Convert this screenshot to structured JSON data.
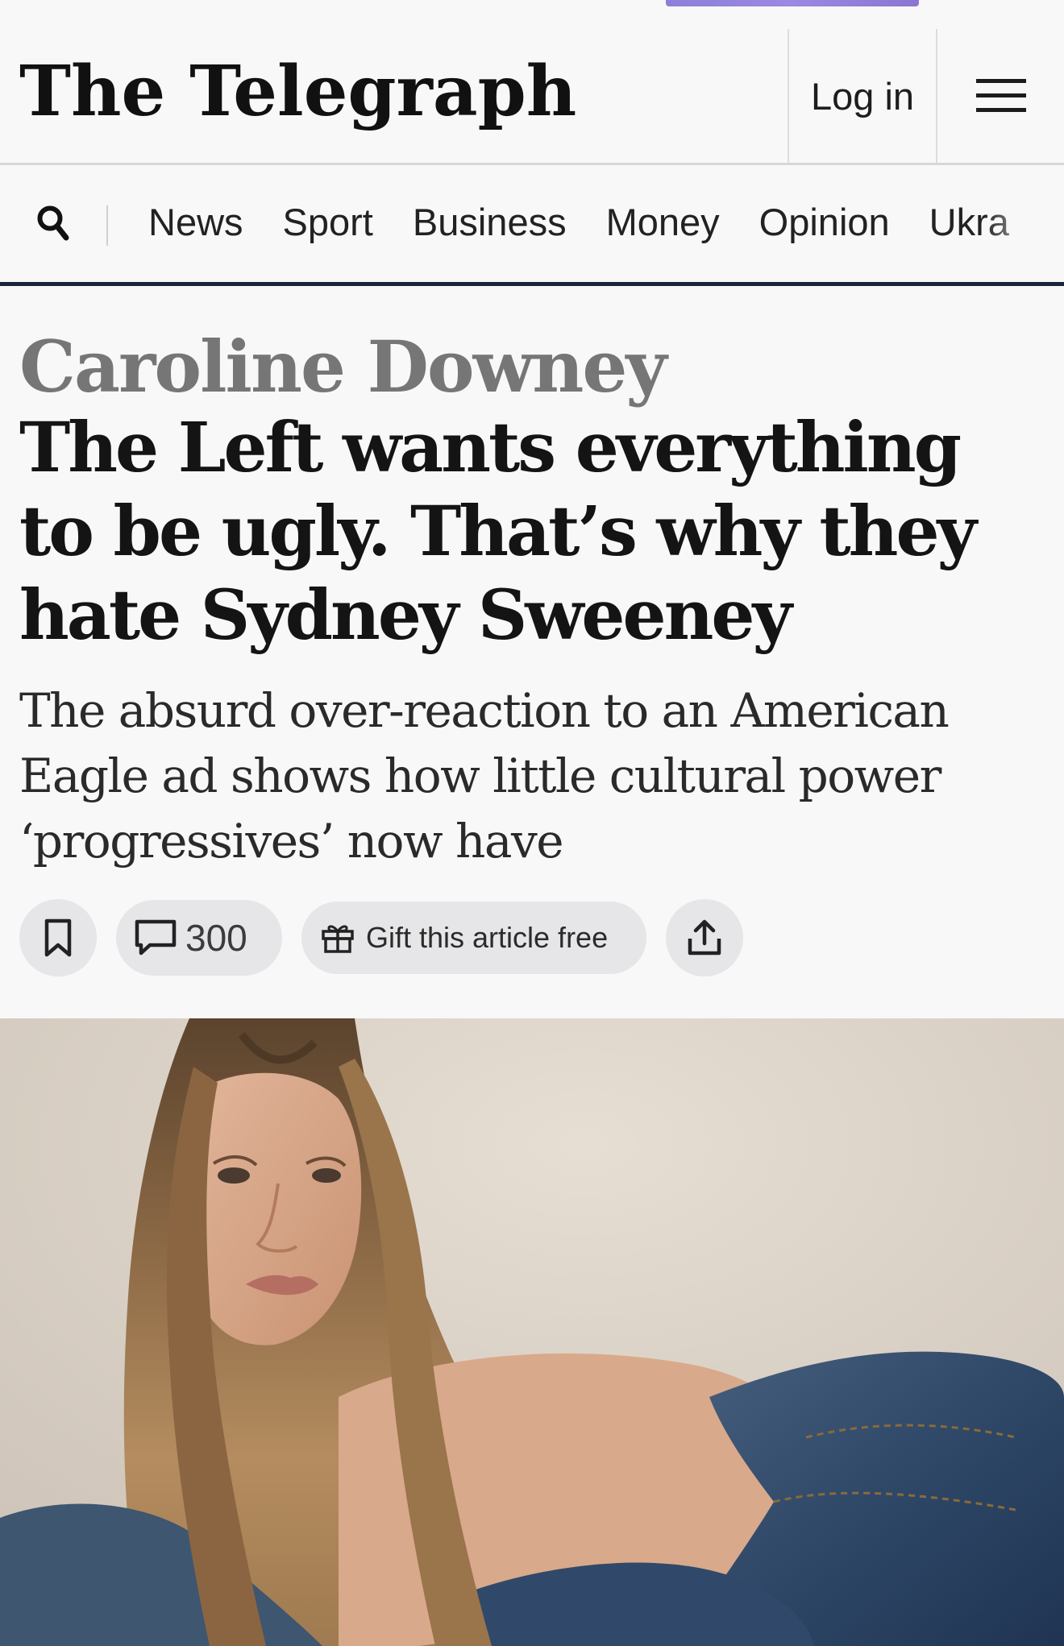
{
  "header": {
    "logo_text": "The Telegraph",
    "login_label": "Log in",
    "menu_icon": "hamburger-menu-icon"
  },
  "nav": {
    "search_icon": "search-icon",
    "items": [
      "News",
      "Sport",
      "Business",
      "Money",
      "Opinion",
      "Ukra"
    ]
  },
  "article": {
    "author": "Caroline Downey",
    "headline": "The Left wants everything to be ugly. That’s why they hate Sydney Sweeney",
    "standfirst": "The absurd over-reaction to an American Eagle ad shows how little cultural power ‘progressives’ now have",
    "actions": {
      "bookmark_icon": "bookmark-icon",
      "comments_icon": "comment-icon",
      "comments_count": "300",
      "gift_icon": "gift-icon",
      "gift_label": "Gift this article free",
      "share_icon": "share-icon"
    }
  },
  "colors": {
    "background": "#f8f8f9",
    "nav_rule": "#18263a",
    "author_gray": "#767676",
    "pill_gray": "#e6e6e8"
  }
}
